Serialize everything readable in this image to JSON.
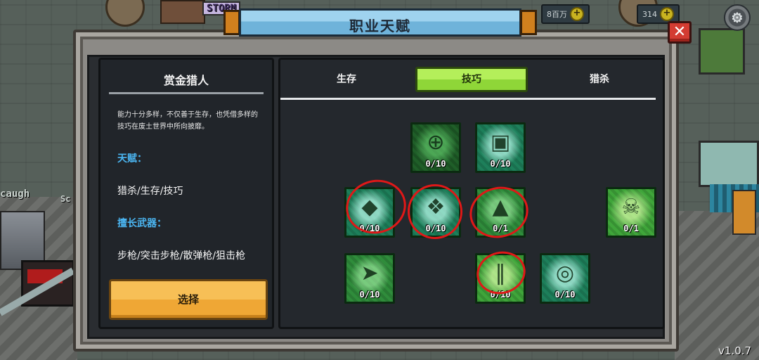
{
  "background": {
    "sign_text": "STORM",
    "left_text": "caugh",
    "left_text2": "Sc"
  },
  "resources": [
    {
      "value": "8百万",
      "icon": "plus-icon"
    },
    {
      "value": "314",
      "icon": "plus-icon"
    }
  ],
  "dialog": {
    "title": "职业天赋",
    "close_icon": "close-icon"
  },
  "class_info": {
    "name": "赏金猎人",
    "description": "能力十分多样，不仅善于生存，也凭借多样的技巧在废土世界中所向披靡。",
    "talent_heading": "天赋：",
    "talent_value": "猎杀/生存/技巧",
    "weapons_heading": "擅长武器：",
    "weapons_value": "步枪/突击步枪/散弹枪/狙击枪",
    "select_label": "选择"
  },
  "tabs": [
    {
      "label": "生存",
      "active": false
    },
    {
      "label": "技巧",
      "active": true
    },
    {
      "label": "猎杀",
      "active": false
    }
  ],
  "skills": [
    {
      "count": "0/10",
      "icon": "crosshair-icon",
      "circled": false
    },
    {
      "count": "0/10",
      "icon": "backpack-icon",
      "circled": false
    },
    {
      "count": "0/10",
      "icon": "crystal-icon",
      "circled": true
    },
    {
      "count": "0/10",
      "icon": "wings-icon",
      "circled": true
    },
    {
      "count": "0/1",
      "icon": "cloak-icon",
      "circled": true
    },
    {
      "count": "0/1",
      "icon": "skull-icon",
      "circled": false
    },
    {
      "count": "0/10",
      "icon": "runner-icon",
      "circled": false
    },
    {
      "count": "0/10",
      "icon": "pillar-icon",
      "circled": true
    },
    {
      "count": "0/10",
      "icon": "swirl-icon",
      "circled": false
    }
  ],
  "version": "v1.0.7",
  "colors": {
    "accent_blue": "#4bb6f2",
    "tab_active": "#9ae045",
    "select_button": "#f2b040",
    "close_button": "#d33c32",
    "annotation_red": "#e01818"
  }
}
